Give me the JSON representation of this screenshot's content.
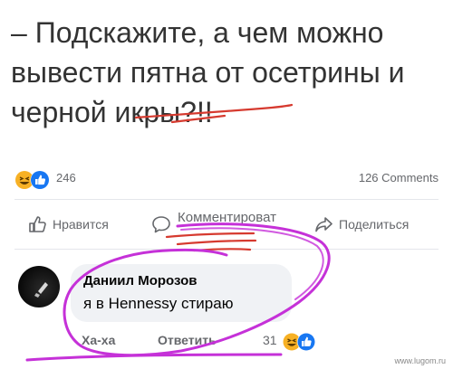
{
  "post": {
    "text": "– Подскажите, а чем можно\nвывести пятна от осетрины и\nчерной икры?!!"
  },
  "stats": {
    "reaction_count": "246",
    "comments_count": "126 Comments"
  },
  "actions": {
    "like_label": "Нравится",
    "comment_label": "Комментироват",
    "share_label": "Поделиться"
  },
  "comment": {
    "author": "Даниил Морозов",
    "text": "я в Hennessy стираю",
    "haha_label": "Ха-ха",
    "reply_label": "Ответить",
    "reaction_count": "31"
  },
  "watermark": "www.lugom.ru",
  "colors": {
    "like_blue": "#1877f2",
    "haha_yellow": "#f7b125",
    "annotation_purple": "#c531d8",
    "annotation_red": "#d63a2f"
  },
  "icons": [
    "haha-icon",
    "like-icon",
    "thumbs-up-icon",
    "comment-icon",
    "share-icon"
  ]
}
